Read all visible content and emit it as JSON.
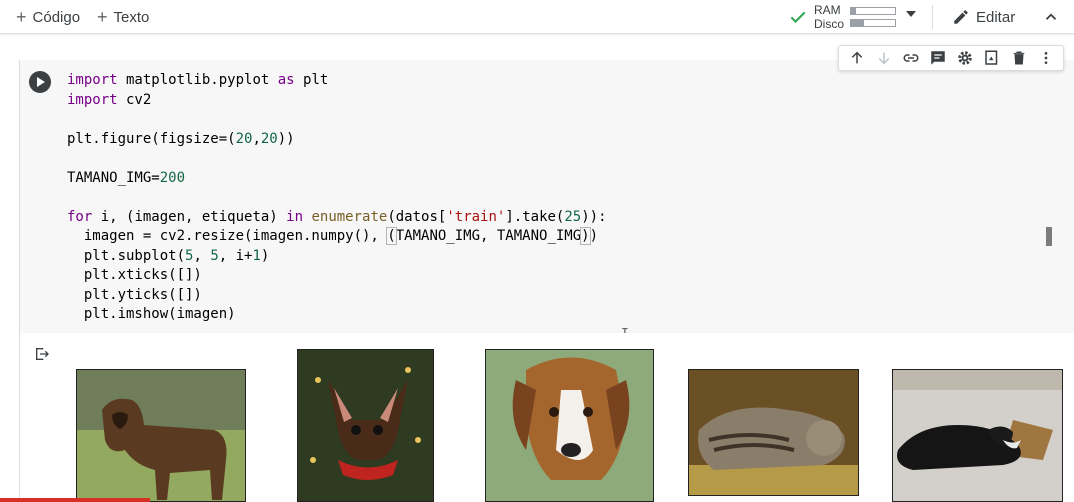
{
  "toolbar": {
    "add_code_label": "Código",
    "add_text_label": "Texto",
    "ram_label": "RAM",
    "disk_label": "Disco",
    "ram_usage": 0.12,
    "disk_usage": 0.3,
    "edit_label": "Editar",
    "status_color": "#34a853"
  },
  "cell_toolbar": {
    "icons": [
      "arrow-up-icon",
      "arrow-down-icon",
      "link-icon",
      "comment-icon",
      "gear-icon",
      "mirror-cell-icon",
      "trash-icon",
      "more-vert-icon"
    ]
  },
  "code": {
    "line1_kw": "import",
    "line1_rest": " matplotlib.pyplot ",
    "line1_as": "as",
    "line1_end": " plt",
    "line2_kw": "import",
    "line2_rest": " cv2",
    "line4_a": "plt.figure(figsize=(",
    "line4_n1": "20",
    "line4_comma": ",",
    "line4_n2": "20",
    "line4_end": "))",
    "line6_a": "TAMANO_IMG=",
    "line6_n": "200",
    "line8_for": "for",
    "line8_a": " i, (imagen, etiqueta) ",
    "line8_in": "in",
    "line8_sp": " ",
    "line8_enum": "enumerate",
    "line8_b": "(datos[",
    "line8_str": "'train'",
    "line8_c": "].take(",
    "line8_n": "25",
    "line8_end": ")):",
    "line9_a": "  imagen = cv2.resize(imagen.numpy(), ",
    "line9_b": "(",
    "line9_c": "TAMANO_IMG, TAMANO_IMG",
    "line9_d": ")",
    "line9_e": ")",
    "line10_a": "  plt.subplot(",
    "line10_n1": "5",
    "line10_b": ", ",
    "line10_n2": "5",
    "line10_c": ", i+",
    "line10_n3": "1",
    "line10_d": ")",
    "line11": "  plt.xticks([])",
    "line12": "  plt.yticks([])",
    "line13": "  plt.imshow(imagen)"
  },
  "output": {
    "icon": "output-redirect-icon",
    "images": [
      "boxer-dog-photo",
      "chihuahua-photo",
      "beagle-photo",
      "tabby-cat-photo",
      "black-white-dog-photo"
    ]
  }
}
